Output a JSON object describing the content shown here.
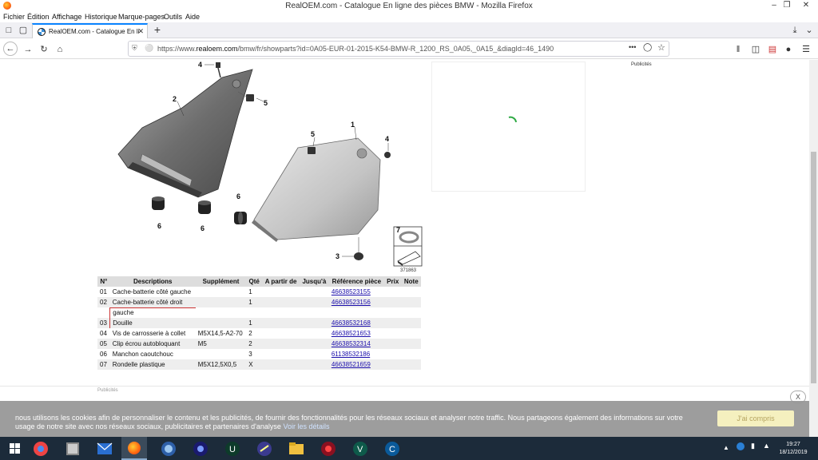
{
  "window": {
    "title": "RealOEM.com - Catalogue En ligne des pièces BMW - Mozilla Firefox",
    "minimize": "–",
    "restore": "❐",
    "close": "✕"
  },
  "menu": [
    "Fichier",
    "Édition",
    "Affichage",
    "Historique",
    "Marque-pages",
    "Outils",
    "Aide"
  ],
  "tab": {
    "label": "RealOEM.com - Catalogue En li",
    "close": "✕"
  },
  "nav": {
    "url_prefix": "https://www.",
    "url_domain": "realoem.com",
    "url_rest": "/bmw/fr/showparts?id=0A05-EUR-01-2015-K54-BMW-R_1200_RS_0A05,_0A15_&diagId=46_1490",
    "more": "•••"
  },
  "ads": {
    "right_label": "Publicités",
    "bottom_label": "Publicités"
  },
  "diagram": {
    "callouts": [
      "4",
      "2",
      "5",
      "1",
      "5",
      "4",
      "6",
      "6",
      "6",
      "3",
      "7"
    ],
    "ref_number": "371863"
  },
  "table": {
    "headers": [
      "N°",
      "Descriptions",
      "Supplément",
      "Qté",
      "A partir de",
      "Jusqu'à",
      "Référence pièce",
      "Prix",
      "Note"
    ],
    "rows": [
      {
        "no": "01",
        "desc": "Cache-batterie côté gauche",
        "supp": "",
        "qty": "1",
        "ref": "46638523155"
      },
      {
        "no": "02",
        "desc": "Cache-batterie côté droit",
        "supp": "",
        "qty": "1",
        "ref": "46638523156"
      },
      {
        "no": "03",
        "desc": "Douille",
        "supp": "",
        "qty": "1",
        "ref": "46638532168"
      },
      {
        "no": "04",
        "desc": "Vis de carrosserie à collet",
        "supp": "M5X14,5-A2-70",
        "qty": "2",
        "ref": "46638521653"
      },
      {
        "no": "05",
        "desc": "Clip écrou autobloquant",
        "supp": "M5",
        "qty": "2",
        "ref": "46638532314"
      },
      {
        "no": "06",
        "desc": "Manchon caoutchouc",
        "supp": "",
        "qty": "3",
        "ref": "61138532186"
      },
      {
        "no": "07",
        "desc": "Rondelle plastique",
        "supp": "M5X12,5X0,5",
        "qty": "X",
        "ref": "46638521659"
      }
    ],
    "note_row": "gauche"
  },
  "cookie": {
    "text": "nous utilisons les cookies afin de personnaliser le contenu et les publicités, de fournir des fonctionnalités pour les réseaux sociaux et analyser notre traffic. Nous partageons également des informations sur votre usage de notre site avec nos réseaux sociaux, publicitaires et partenaires d'analyse",
    "link": "Voir les détails",
    "accept": "J'ai compris",
    "close": "X"
  },
  "taskbar": {
    "time": "19:27",
    "date": "18/12/2019"
  }
}
